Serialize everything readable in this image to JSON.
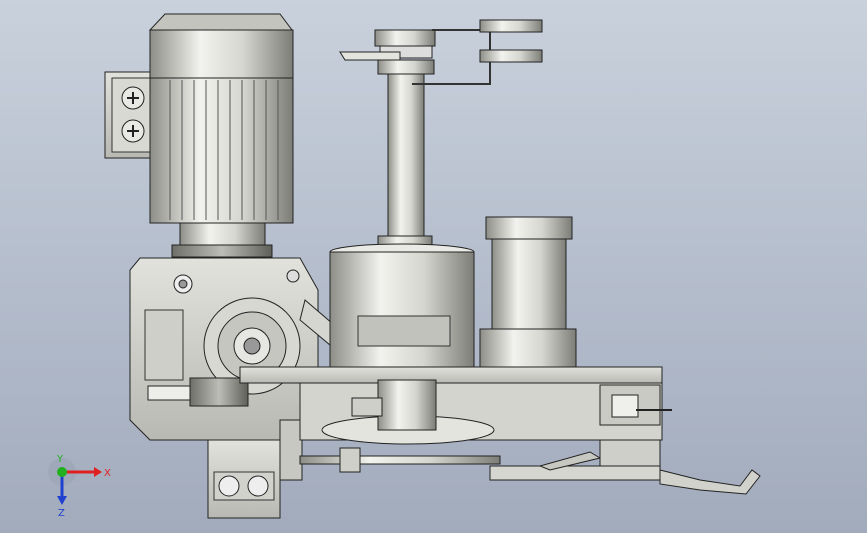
{
  "viewport": {
    "background_top": "#c9d1dc",
    "background_bottom": "#a2abbc",
    "part_color": "#d3d3ce",
    "edge_color": "#202020"
  },
  "triad": {
    "x_label": "X",
    "y_label": "Y",
    "z_label": "Z",
    "x_color": "#e02020",
    "y_color": "#20b020",
    "z_color": "#2040d0"
  }
}
